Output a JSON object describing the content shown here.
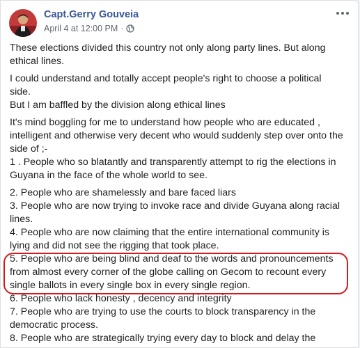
{
  "post": {
    "author": "Capt.Gerry Gouveia",
    "timestamp": "April 4 at 12:00 PM",
    "separator": "·",
    "privacy_icon": "globe-icon",
    "more_icon": "more-options-icon",
    "highlight_color": "#d7191c",
    "paragraphs": [
      {
        "lines": [
          "These elections divided this country not only along party lines. But along",
          "ethical lines."
        ]
      },
      {
        "lines": [
          "I could understand and totally accept people's right to choose a political",
          "side.",
          "But I am baffled by the division along ethical lines"
        ]
      },
      {
        "lines": [
          "It's mind boggling for me to understand how people who are educated ,",
          "intelligent and otherwise very decent who would suddenly step over onto the",
          "side of ;-",
          "1 . People who so blatantly and transparently attempt to rig the elections in",
          "Guyana in the face of the whole world to see."
        ]
      },
      {
        "lines": [
          "2. People who are shamelessly and bare faced liars",
          "3. People who are now trying to invoke race and divide Guyana along racial",
          "lines.",
          "4. People who are now claiming that the entire international community is",
          "lying and did not see the rigging that took place.",
          "5. People who are being blind and deaf to the words and pronouncements",
          "from almost every corner of the globe calling on Gecom to recount every",
          "single ballots in every single box in every single region.",
          "6. People who lack honesty , decency and integrity",
          "7. People who are trying to use the courts to block transparency in the",
          "democratic process.",
          "8. People who are strategically trying every day to block and delay the"
        ]
      }
    ]
  }
}
